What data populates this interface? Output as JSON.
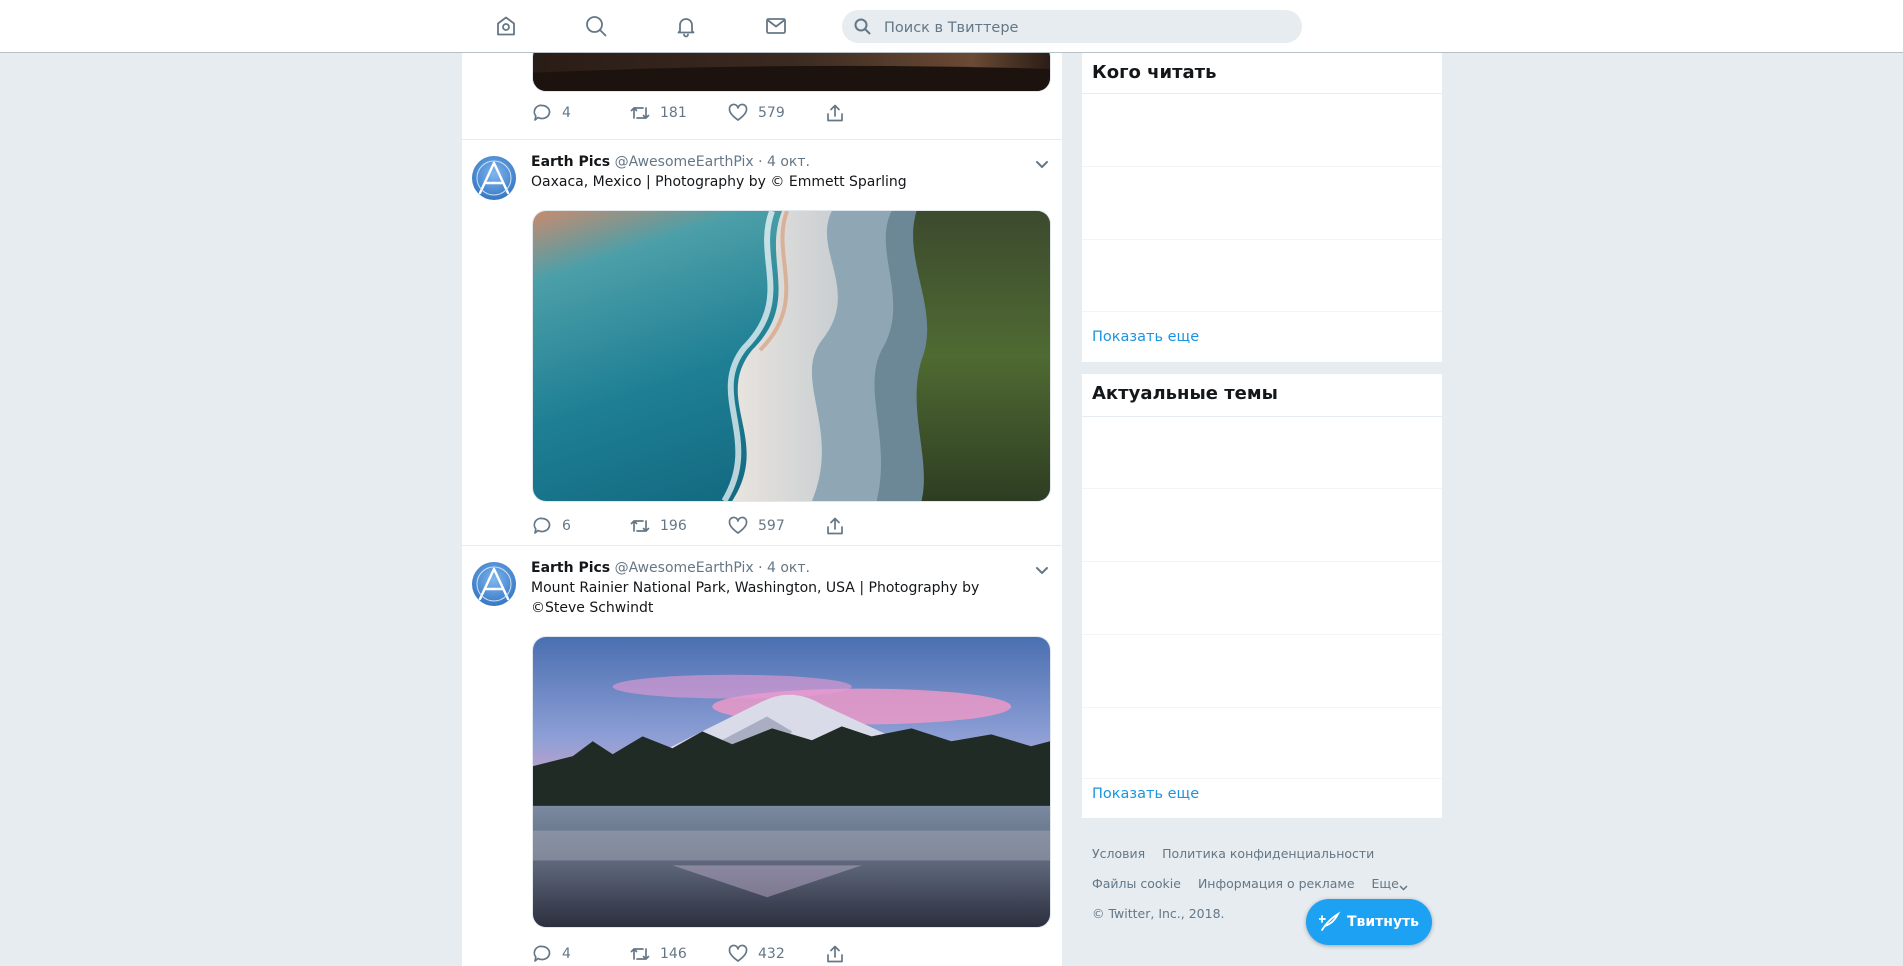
{
  "topbar": {
    "icons": [
      "home-icon",
      "explore-icon",
      "notifications-icon",
      "messages-icon"
    ],
    "search": {
      "placeholder": "Поиск в Твиттере",
      "value": ""
    }
  },
  "timeline": {
    "first_tweet_actions": {
      "replies": "4",
      "retweets": "181",
      "likes": "579"
    },
    "tweets": [
      {
        "name": "Earth Pics",
        "handle": "@AwesomeEarthPix",
        "separator": "·",
        "date": "4 окт.",
        "text": "Oaxaca, Mexico | Photography by © Emmett Sparling",
        "replies": "6",
        "retweets": "196",
        "likes": "597"
      },
      {
        "name": "Earth Pics",
        "handle": "@AwesomeEarthPix",
        "separator": "·",
        "date": "4 окт.",
        "text": "Mount Rainier National Park, Washington, USA | Photography by ©Steve Schwindt",
        "replies": "4",
        "retweets": "146",
        "likes": "432"
      }
    ]
  },
  "sidebar": {
    "who_to_follow": {
      "title": "Кого читать",
      "more": "Показать еще"
    },
    "trends": {
      "title": "Актуальные темы",
      "more": "Показать еще"
    }
  },
  "footer": {
    "links_row1": [
      "Условия",
      "Политика конфиденциальности"
    ],
    "links_row2": [
      "Файлы cookie",
      "Информация о рекламе",
      "Еще"
    ],
    "copyright": "© Twitter, Inc., 2018."
  },
  "tweet_button": {
    "label": "Твитнуть"
  },
  "colors": {
    "accent": "#1da1f2",
    "link": "#1b95e0",
    "background": "#e6ecf0",
    "muted": "#657786"
  }
}
